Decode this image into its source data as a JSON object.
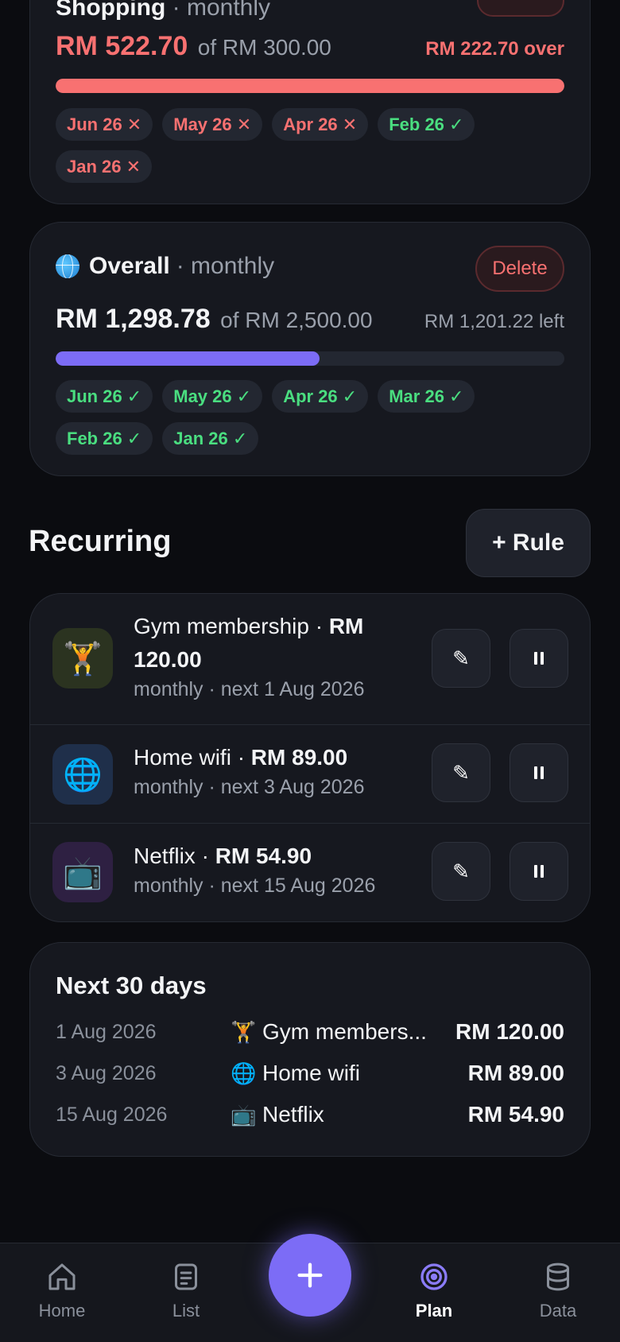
{
  "budgets": [
    {
      "id": "shopping",
      "name": "Shopping",
      "period": "· monthly",
      "spent": "RM 522.70",
      "of": "of RM 300.00",
      "status": "RM 222.70 over",
      "progress_fraction": 1.0,
      "months": [
        {
          "label": "Jun 26 ✕",
          "ok": false
        },
        {
          "label": "May 26 ✕",
          "ok": false
        },
        {
          "label": "Apr 26 ✕",
          "ok": false
        },
        {
          "label": "Feb 26 ✓",
          "ok": true
        },
        {
          "label": "Jan 26 ✕",
          "ok": false
        }
      ]
    },
    {
      "id": "overall",
      "name": "Overall",
      "period": "· monthly",
      "delete_label": "Delete",
      "spent": "RM 1,298.78",
      "of": "of RM 2,500.00",
      "status": "RM 1,201.22 left",
      "progress_fraction": 0.5195,
      "months": [
        {
          "label": "Jun 26 ✓",
          "ok": true
        },
        {
          "label": "May 26 ✓",
          "ok": true
        },
        {
          "label": "Apr 26 ✓",
          "ok": true
        },
        {
          "label": "Mar 26 ✓",
          "ok": true
        },
        {
          "label": "Feb 26 ✓",
          "ok": true
        },
        {
          "label": "Jan 26 ✓",
          "ok": true
        }
      ]
    }
  ],
  "recurring": {
    "title": "Recurring",
    "add_rule_label": "+ Rule",
    "items": [
      {
        "icon": "weightlifter-emoji",
        "emoji": "🏋️",
        "name": "Gym membership · ",
        "amount": "RM 120.00",
        "schedule": "monthly · next 1 Aug 2026"
      },
      {
        "icon": "globe-emoji",
        "emoji": "🌐",
        "name": "Home wifi · ",
        "amount": "RM 89.00",
        "schedule": "monthly · next 3 Aug 2026"
      },
      {
        "icon": "television-emoji",
        "emoji": "📺",
        "name": "Netflix · ",
        "amount": "RM 54.90",
        "schedule": "monthly · next 15 Aug 2026"
      }
    ]
  },
  "upcoming": {
    "title": "Next 30 days",
    "rows": [
      {
        "date": "1 Aug 2026",
        "emoji": "🏋️",
        "name": "Gym members...",
        "amount": "RM 120.00"
      },
      {
        "date": "3 Aug 2026",
        "emoji": "🌐",
        "name": "Home wifi",
        "amount": "RM 89.00"
      },
      {
        "date": "15 Aug 2026",
        "emoji": "📺",
        "name": "Netflix",
        "amount": "RM 54.90"
      }
    ]
  },
  "nav": {
    "items": [
      {
        "label": "Home",
        "icon": "home-icon",
        "active": false
      },
      {
        "label": "List",
        "icon": "list-icon",
        "active": false
      },
      {
        "label": "Plan",
        "icon": "target-icon",
        "active": true
      },
      {
        "label": "Data",
        "icon": "database-icon",
        "active": false
      }
    ],
    "fab_icon": "plus-icon"
  },
  "colors": {
    "accent": "#7c6cf6",
    "over": "#f87171",
    "ok": "#4ade80"
  }
}
